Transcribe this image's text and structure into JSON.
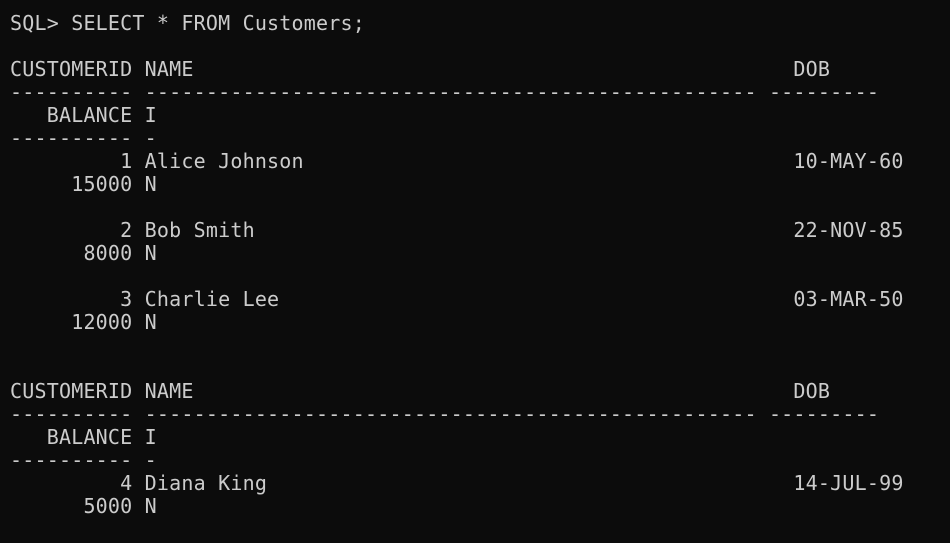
{
  "terminal": {
    "prompt": "SQL> SELECT * FROM Customers;",
    "background": "#0c0c0c",
    "foreground": "#cccccc"
  },
  "page1": {
    "header1": "CUSTOMERID NAME                                                 DOB",
    "sep1": "---------- -------------------------------------------------- ---------",
    "header2": "   BALANCE I",
    "sep2": "---------- -",
    "rows": [
      {
        "line1": "         1 Alice Johnson                                        10-MAY-60",
        "line2": "     15000 N"
      },
      {
        "line1": "         2 Bob Smith                                            22-NOV-85",
        "line2": "      8000 N"
      },
      {
        "line1": "         3 Charlie Lee                                          03-MAR-50",
        "line2": "     12000 N"
      }
    ]
  },
  "page2": {
    "header1": "CUSTOMERID NAME                                                 DOB",
    "sep1": "---------- -------------------------------------------------- ---------",
    "header2": "   BALANCE I",
    "sep2": "---------- -",
    "rows": [
      {
        "line1": "         4 Diana King                                           14-JUL-99",
        "line2": "      5000 N"
      }
    ]
  }
}
